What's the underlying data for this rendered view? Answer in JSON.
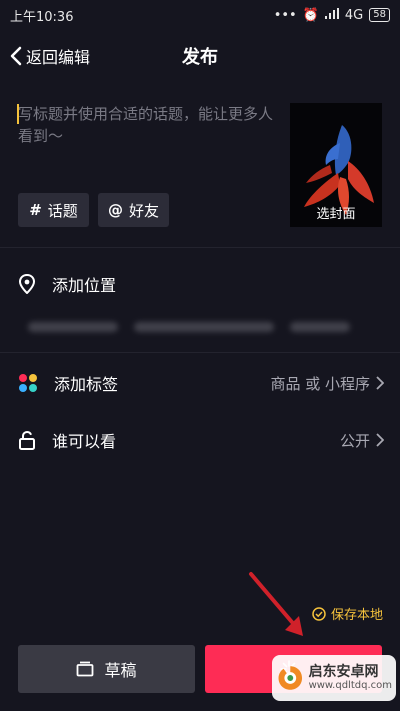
{
  "status": {
    "time": "上午10:36",
    "network": "4G",
    "battery": "58"
  },
  "nav": {
    "back_label": "返回编辑",
    "title": "发布"
  },
  "description": {
    "placeholder": "写标题并使用合适的话题，能让更多人看到～"
  },
  "cover": {
    "label": "选封面"
  },
  "chips": [
    {
      "symbol": "#",
      "label": "话题"
    },
    {
      "symbol": "@",
      "label": "好友"
    }
  ],
  "rows": {
    "location": {
      "label": "添加位置"
    },
    "tag": {
      "label": "添加标签",
      "value": "商品 或 小程序"
    },
    "visibility": {
      "label": "谁可以看",
      "value": "公开"
    }
  },
  "save_local": {
    "label": "保存本地"
  },
  "buttons": {
    "draft": "草稿",
    "publish": ""
  },
  "watermark": {
    "title": "启东安卓网",
    "url": "www.qdltdq.com"
  },
  "colors": {
    "accent": "#fe2c55",
    "highlight": "#f5c23c",
    "background": "#15151f"
  }
}
